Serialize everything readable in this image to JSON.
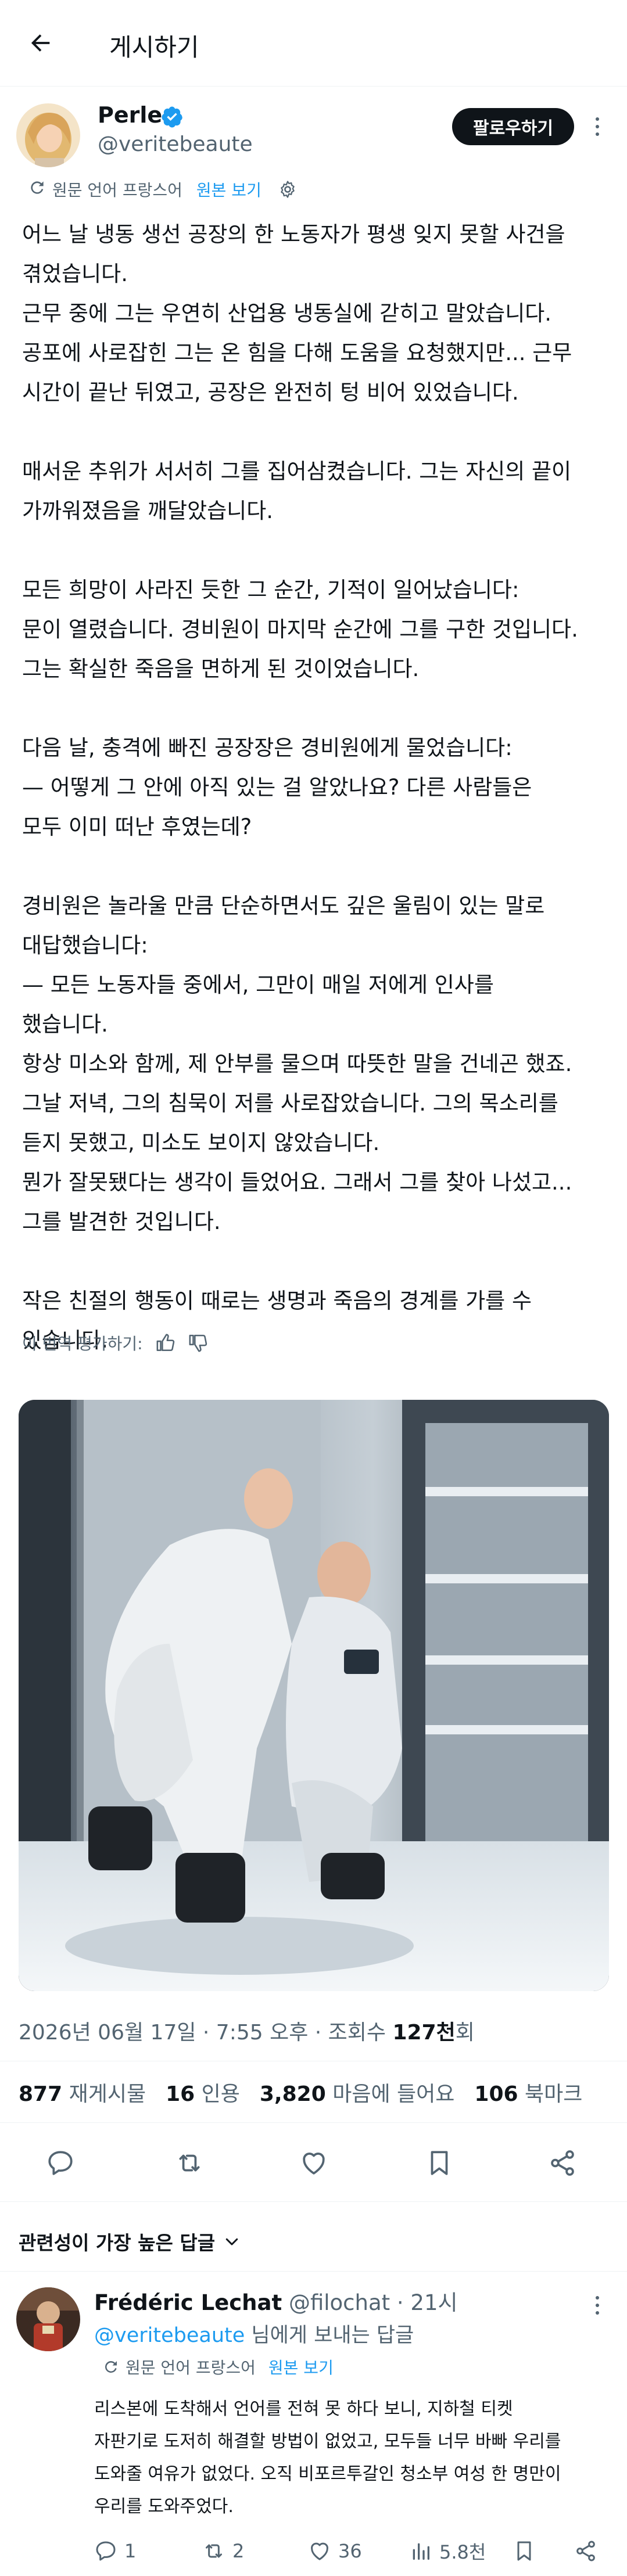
{
  "header": {
    "title": "게시하기"
  },
  "post": {
    "author_name": "Perle",
    "author_handle": "@veritebeaute",
    "follow_label": "팔로우하기",
    "translated_from": "원문 언어 프랑스어",
    "show_original": "원본 보기",
    "body_lines": [
      [
        "어느 날 냉동 생선 공장의 한 노동자가 평생 잊지 못할 사건을",
        "겪었습니다.",
        "근무 중에 그는 우연히 산업용 냉동실에 갇히고 말았습니다.",
        "공포에 사로잡힌 그는 온 힘을 다해 도움을 요청했지만... 근무",
        "시간이 끝난 뒤였고, 공장은 완전히 텅 비어 있었습니다."
      ],
      [
        "매서운 추위가 서서히 그를 집어삼켰습니다. 그는 자신의 끝이",
        "가까워졌음을 깨달았습니다."
      ],
      [
        "모든 희망이 사라진 듯한 그 순간, 기적이 일어났습니다:",
        "문이 열렸습니다. 경비원이 마지막 순간에 그를 구한 것입니다.",
        "그는 확실한 죽음을 면하게 된 것이었습니다."
      ],
      [
        "다음 날, 충격에 빠진 공장장은 경비원에게 물었습니다:",
        "— 어떻게 그 안에 아직 있는 걸 알았나요? 다른 사람들은",
        "모두 이미 떠난 후였는데?"
      ],
      [
        "경비원은 놀라울 만큼 단순하면서도 깊은 울림이 있는 말로",
        "대답했습니다:",
        "— 모든 노동자들 중에서, 그만이 매일 저에게 인사를",
        "했습니다.",
        "항상 미소와 함께, 제 안부를 물으며 따뜻한 말을 건네곤 했죠.",
        "그날 저녁, 그의 침묵이 저를 사로잡았습니다. 그의 목소리를",
        "듣지 못했고, 미소도 보이지 않았습니다.",
        "뭔가 잘못됐다는 생각이 들었어요. 그래서 그를 찾아 나섰고...",
        "그를 발견한 것입니다."
      ],
      [
        "작은 친절의 행동이 때로는 생명과 죽음의 경계를 가를 수",
        "있습니다."
      ]
    ],
    "rate_translation": "이 번역 평가하기:",
    "date": "2026년 06월 17일 · 7:55 오후 · 조회수 ",
    "views": "127천",
    "views_suffix": "회",
    "stats": [
      {
        "count": "877",
        "label": "재게시물"
      },
      {
        "count": "16",
        "label": "인용"
      },
      {
        "count": "3,820",
        "label": "마음에 들어요"
      },
      {
        "count": "106",
        "label": "북마크"
      }
    ]
  },
  "replies_sort": "관련성이 가장 높은 답글",
  "reply": {
    "author_name": "Frédéric Lechat",
    "author_handle": "@filochat",
    "time": "· 21시",
    "reply_to_handle": "@veritebeaute",
    "reply_to_suffix": " 님에게 보내는 답글",
    "translated_from": "원문 언어 프랑스어",
    "show_original": "원본 보기",
    "body_lines": [
      "리스본에 도착해서 언어를 전혀 못 하다 보니, 지하철 티켓",
      "자판기로 도저히 해결할 방법이 없었고, 모두들 너무 바빠 우리를",
      "도와줄 여유가 없었다. 오직 비포르투갈인 청소부 여성 한 명만이",
      "우리를 도와주었다."
    ],
    "replies": "1",
    "reposts": "2",
    "likes": "36",
    "views": "5.8천"
  },
  "colors": {
    "accent": "#1d9bf0",
    "text": "#0f1419",
    "muted": "#536471",
    "button": "#0f1419"
  }
}
